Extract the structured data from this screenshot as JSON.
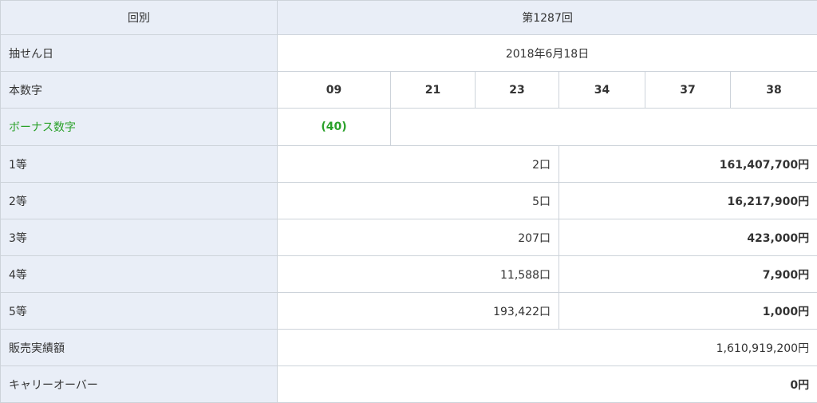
{
  "header": {
    "label": "回別",
    "value": "第1287回"
  },
  "draw_date": {
    "label": "抽せん日",
    "value": "2018年6月18日"
  },
  "main_numbers": {
    "label": "本数字",
    "values": [
      "09",
      "21",
      "23",
      "34",
      "37",
      "38"
    ]
  },
  "bonus": {
    "label": "ボーナス数字",
    "value": "(40)",
    "color": "#2aa12a"
  },
  "prizes": [
    {
      "label": "1等",
      "winners": "2口",
      "amount": "161,407,700円"
    },
    {
      "label": "2等",
      "winners": "5口",
      "amount": "16,217,900円"
    },
    {
      "label": "3等",
      "winners": "207口",
      "amount": "423,000円"
    },
    {
      "label": "4等",
      "winners": "11,588口",
      "amount": "7,900円"
    },
    {
      "label": "5等",
      "winners": "193,422口",
      "amount": "1,000円"
    }
  ],
  "sales": {
    "label": "販売実績額",
    "value": "1,610,919,200円"
  },
  "carryover": {
    "label": "キャリーオーバー",
    "value": "0円"
  },
  "colors": {
    "label_background": "#e9eef7",
    "border": "#cdd3da",
    "bonus_green": "#2aa12a"
  }
}
